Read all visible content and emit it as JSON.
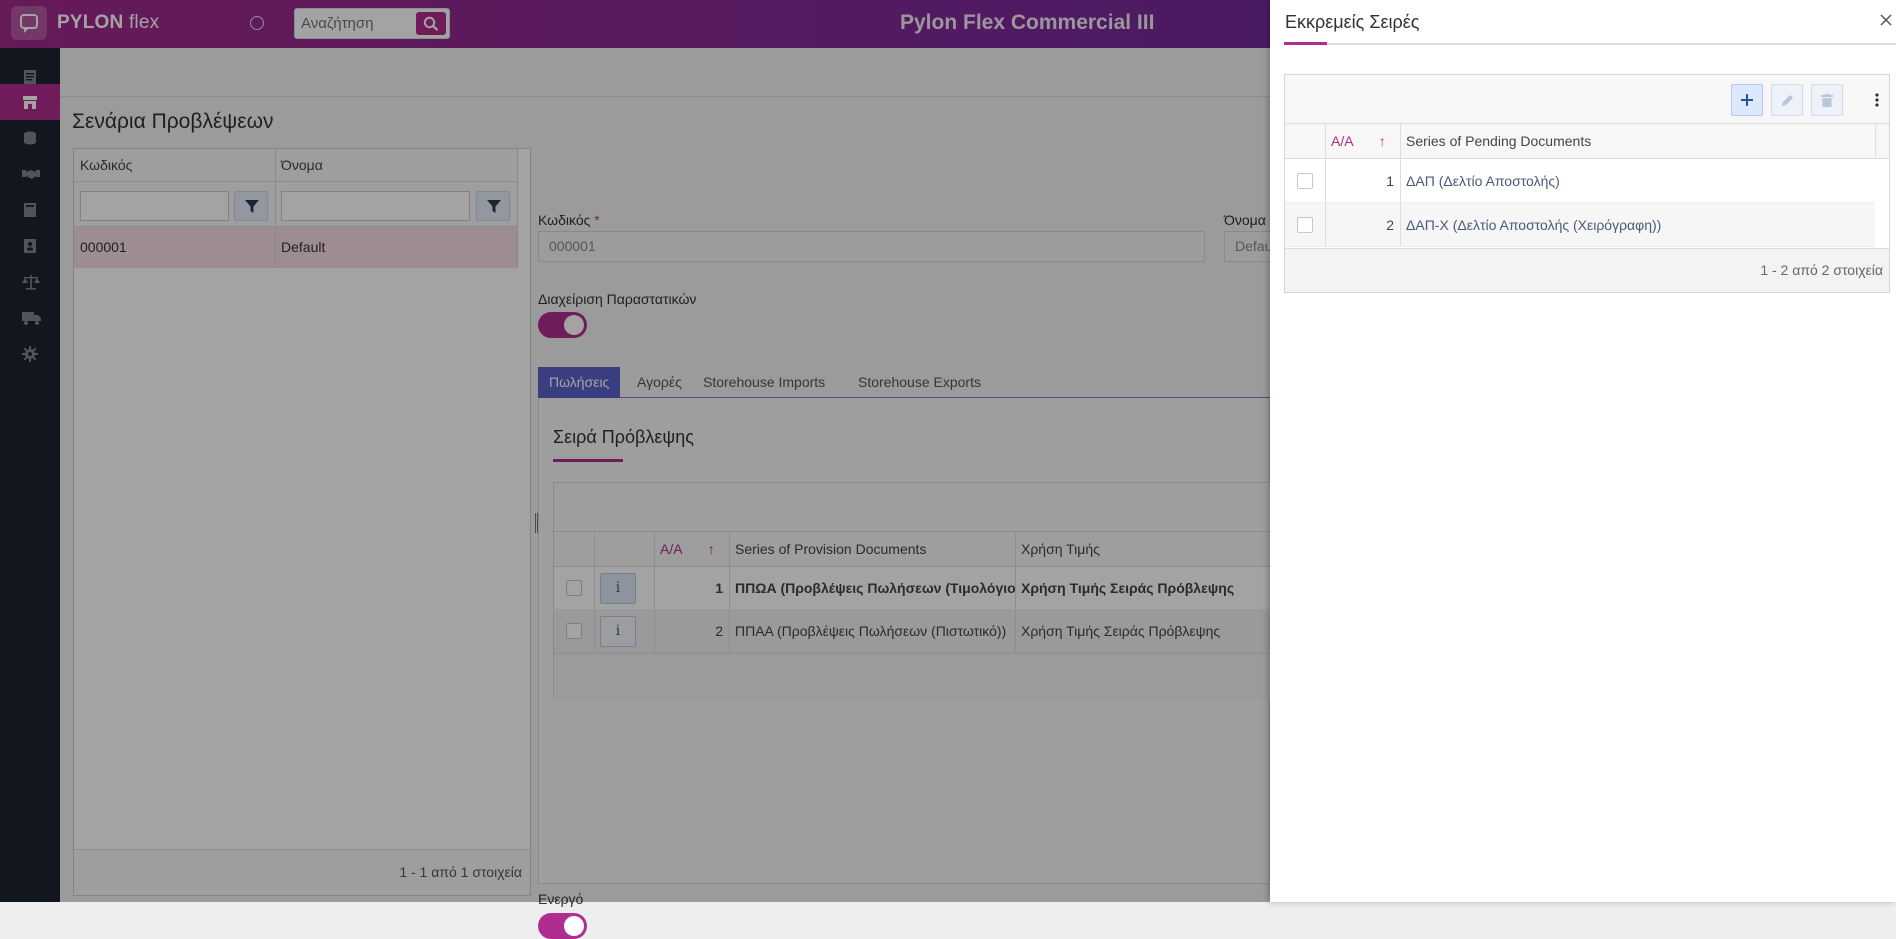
{
  "topbar": {
    "logo_text": "PYLON",
    "logo_suffix": "flex",
    "search_placeholder": "Αναζήτηση",
    "app_title": "Pylon Flex Commercial III"
  },
  "sidebar": {
    "items": [
      {
        "icon": "document-icon",
        "active": false
      },
      {
        "icon": "store-icon",
        "active": true
      },
      {
        "icon": "coins-icon",
        "active": false
      },
      {
        "icon": "handshake-icon",
        "active": false
      },
      {
        "icon": "book-icon",
        "active": false
      },
      {
        "icon": "contacts-icon",
        "active": false
      },
      {
        "icon": "scales-icon",
        "active": false
      },
      {
        "icon": "truck-icon",
        "active": false
      },
      {
        "icon": "gear-icon",
        "active": false
      }
    ]
  },
  "main": {
    "page_title": "Σενάρια Προβλέψεων",
    "left_grid": {
      "columns": [
        "Κωδικός",
        "Όνομα"
      ],
      "rows": [
        {
          "code": "000001",
          "name": "Default"
        }
      ],
      "footer": "1 - 1 από 1 στοιχεία"
    },
    "form": {
      "code_label": "Κωδικός",
      "code_required": "*",
      "code_value": "000001",
      "name_label": "Όνομα",
      "name_value": "Default",
      "docs_label": "Διαχείριση Παραστατικών",
      "active_label": "Ενεργό"
    },
    "tabs": [
      "Πωλήσεις",
      "Αγορές",
      "Storehouse Imports",
      "Storehouse Exports"
    ],
    "section_title": "Σειρά Πρόβλεψης",
    "provision_grid": {
      "columns": {
        "aa": "Α/Α",
        "series": "Series of Provision Documents",
        "price": "Χρήση Τιμής"
      },
      "info_label": "i",
      "rows": [
        {
          "aa": "1",
          "series": "ΠΠΩΑ (Προβλέψεις Πωλήσεων (Τιμολόγιο))",
          "price": "Χρήση Τιμής Σειράς Πρόβλεψης",
          "bold": true
        },
        {
          "aa": "2",
          "series": "ΠΠΑΑ (Προβλέψεις Πωλήσεων (Πιστωτικό))",
          "price": "Χρήση Τιμής Σειράς Πρόβλεψης",
          "bold": false
        }
      ]
    }
  },
  "drawer": {
    "title": "Εκκρεμείς Σειρές",
    "columns": {
      "aa": "Α/Α",
      "series": "Series of Pending Documents"
    },
    "rows": [
      {
        "aa": "1",
        "series": "ΔΑΠ (Δελτίο Αποστολής)"
      },
      {
        "aa": "2",
        "series": "ΔΑΠ-Χ (Δελτίο Αποστολής (Χειρόγραφη))"
      }
    ],
    "footer": "1 - 2 από 2 στοιχεία"
  },
  "colors": {
    "brand": "#b02d8f",
    "tab_active": "#5a62c8",
    "sidebar_bg": "#1d2330"
  }
}
